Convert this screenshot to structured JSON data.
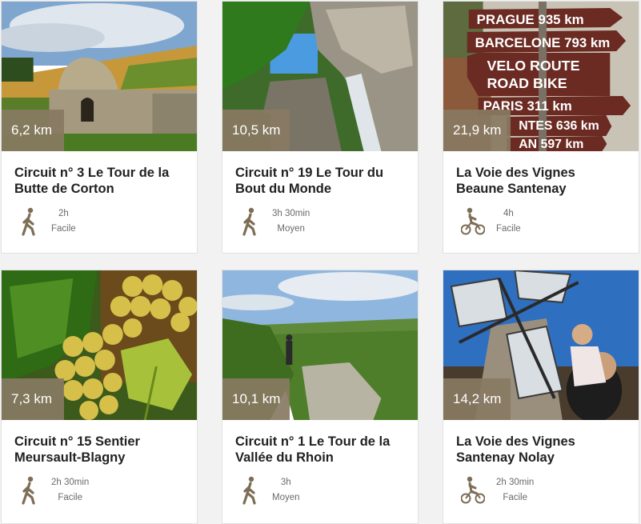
{
  "cards": [
    {
      "distance": "6,2 km",
      "title": "Circuit n° 3 Le Tour de la Butte de Corton",
      "duration": "2h",
      "difficulty": "Facile",
      "mode_icon": "walking-icon",
      "image": "stone-hut-vineyard"
    },
    {
      "distance": "10,5 km",
      "title": "Circuit n° 19 Le Tour du Bout du Monde",
      "duration": "3h 30min",
      "difficulty": "Moyen",
      "mode_icon": "walking-icon",
      "image": "waterfall-cliff"
    },
    {
      "distance": "21,9 km",
      "title": "La Voie des Vignes Beaune Santenay",
      "duration": "4h",
      "difficulty": "Facile",
      "mode_icon": "bike-icon",
      "image": "signpost",
      "sign_lines": [
        "PRAGUE 935 km",
        "BARCELONE 793 km",
        "VELO ROUTE",
        "ROAD BIKE",
        "PARIS 311 km",
        "NTES 636 km",
        "AN 597 km"
      ]
    },
    {
      "distance": "7,3 km",
      "title": "Circuit n° 15 Sentier Meursault-Blagny",
      "duration": "2h 30min",
      "difficulty": "Facile",
      "mode_icon": "walking-icon",
      "image": "grapes"
    },
    {
      "distance": "10,1 km",
      "title": "Circuit n° 1 Le Tour de la Vallée du Rhoin",
      "duration": "3h",
      "difficulty": "Moyen",
      "mode_icon": "walking-icon",
      "image": "valley-view"
    },
    {
      "distance": "14,2 km",
      "title": "La Voie des Vignes Santenay Nolay",
      "duration": "2h 30min",
      "difficulty": "Facile",
      "mode_icon": "bike-icon",
      "image": "windmill-family"
    }
  ],
  "colors": {
    "badge": "#887962",
    "icon": "#7d6d55"
  }
}
